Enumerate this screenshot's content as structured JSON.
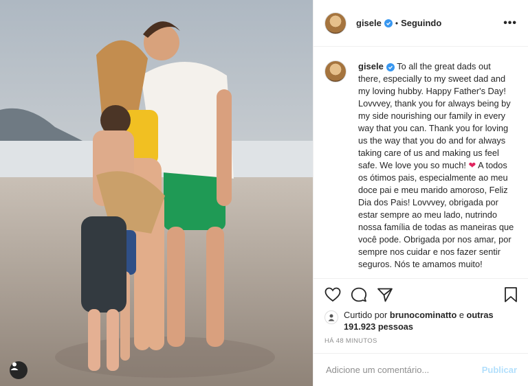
{
  "photo": {
    "alt_icon": "user-tag-icon"
  },
  "header": {
    "username": "gisele",
    "separator": "•",
    "follow_status": "Seguindo",
    "more_icon": "more-options-icon",
    "more_label": "•••"
  },
  "caption": {
    "username": "gisele",
    "text_en": "To all the great dads out there, especially to my sweet dad and my loving hubby. Happy Father's Day! Lovvvey, thank you for always being by my side nourishing our family in every way that you can. Thank you for loving us the way that you do and for always taking care of us and making us feel safe. We love you so much!",
    "heart": "❤",
    "text_pt": "A todos os ótimos pais, especialmente ao meu doce pai e meu marido amoroso, Feliz Dia dos Pais! Lovvvey, obrigada por estar sempre ao meu lado, nutrindo nossa família de todas as maneiras que você pode. Obrigada por nos amar, por sempre nos cuidar e nos fazer sentir seguros. Nós te amamos muito!"
  },
  "actions": {
    "like_icon": "heart-icon",
    "comment_icon": "comment-icon",
    "share_icon": "share-icon",
    "save_icon": "bookmark-icon"
  },
  "likes": {
    "prefix": "Curtido por",
    "liker": "brunocominatto",
    "connector": "e",
    "others": "outras 191.923 pessoas"
  },
  "timestamp": "HÁ 48 MINUTOS",
  "comment": {
    "placeholder": "Adicione um comentário...",
    "submit_label": "Publicar"
  },
  "colors": {
    "verified": "#3897f0",
    "publish_disabled": "#b2dffc",
    "muted": "#8e8e8e"
  }
}
